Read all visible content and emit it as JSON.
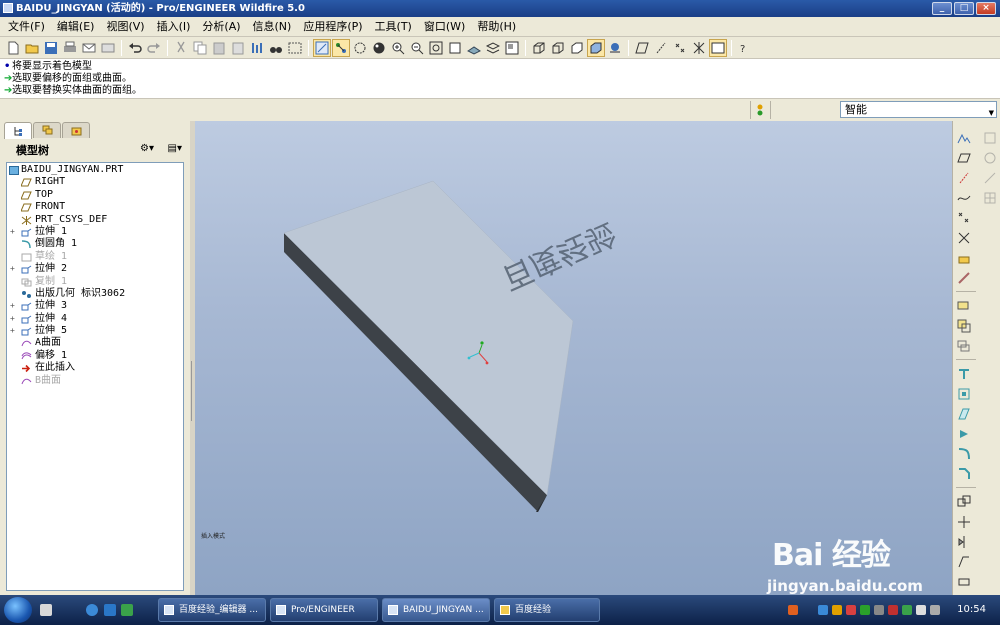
{
  "window": {
    "title": "BAIDU_JINGYAN (活动的) - Pro/ENGINEER Wildfire 5.0",
    "controls": [
      "minimize",
      "maximize",
      "close"
    ]
  },
  "menu": [
    {
      "label": "文件(F)"
    },
    {
      "label": "编辑(E)"
    },
    {
      "label": "视图(V)"
    },
    {
      "label": "插入(I)"
    },
    {
      "label": "分析(A)"
    },
    {
      "label": "信息(N)"
    },
    {
      "label": "应用程序(P)"
    },
    {
      "label": "工具(T)"
    },
    {
      "label": "窗口(W)"
    },
    {
      "label": "帮助(H)"
    }
  ],
  "messages": [
    {
      "text": "将要显示着色模型",
      "kind": "info"
    },
    {
      "text": "选取要偏移的面组或曲面。",
      "kind": "prompt"
    },
    {
      "text": "选取要替换实体曲面的面组。",
      "kind": "prompt"
    }
  ],
  "filter": {
    "selected": "智能"
  },
  "model_tree": {
    "title": "模型树",
    "items": [
      {
        "label": "BAIDU_JINGYAN.PRT",
        "icon": "part-icon",
        "expandable": false,
        "dim": false,
        "root": true
      },
      {
        "label": "RIGHT",
        "icon": "datum-plane-icon",
        "expandable": false,
        "dim": false
      },
      {
        "label": "TOP",
        "icon": "datum-plane-icon",
        "expandable": false,
        "dim": false
      },
      {
        "label": "FRONT",
        "icon": "datum-plane-icon",
        "expandable": false,
        "dim": false
      },
      {
        "label": "PRT_CSYS_DEF",
        "icon": "csys-icon",
        "expandable": false,
        "dim": false
      },
      {
        "label": "拉伸 1",
        "icon": "extrude-icon",
        "expandable": true,
        "dim": false
      },
      {
        "label": "倒圆角 1",
        "icon": "round-icon",
        "expandable": false,
        "dim": false
      },
      {
        "label": "草绘 1",
        "icon": "sketch-icon",
        "expandable": false,
        "dim": true
      },
      {
        "label": "拉伸 2",
        "icon": "extrude-icon",
        "expandable": true,
        "dim": false
      },
      {
        "label": "复制 1",
        "icon": "copy-icon",
        "expandable": false,
        "dim": true
      },
      {
        "label": "出版几何 标识3062",
        "icon": "publish-geom-icon",
        "expandable": false,
        "dim": false
      },
      {
        "label": "拉伸 3",
        "icon": "extrude-icon",
        "expandable": true,
        "dim": false
      },
      {
        "label": "拉伸 4",
        "icon": "extrude-icon",
        "expandable": true,
        "dim": false
      },
      {
        "label": "拉伸 5",
        "icon": "extrude-icon",
        "expandable": true,
        "dim": false
      },
      {
        "label": "A曲面",
        "icon": "surface-icon",
        "expandable": false,
        "dim": false
      },
      {
        "label": "偏移 1",
        "icon": "offset-icon",
        "expandable": false,
        "dim": false
      },
      {
        "label": "在此插入",
        "icon": "insert-here-icon",
        "expandable": false,
        "dim": false
      },
      {
        "label": "B曲面",
        "icon": "surface-icon",
        "expandable": false,
        "dim": true
      }
    ]
  },
  "graphics": {
    "engraved_text": "百度经验",
    "mode_label": "插入模式"
  },
  "watermark": {
    "brand": "Bai 经验",
    "url": "jingyan.baidu.com"
  },
  "taskbar": {
    "tasks": [
      {
        "label": "百度经验_编辑器 ...",
        "active": false
      },
      {
        "label": "Pro/ENGINEER",
        "active": false
      },
      {
        "label": "BAIDU_JINGYAN ...",
        "active": true
      },
      {
        "label": "百度经验",
        "active": false
      }
    ],
    "clock": "10:54"
  },
  "colors": {
    "titlebar": "#1f4a95",
    "panel": "#ece9d8",
    "graphics_top": "#bdcbe1",
    "graphics_bottom": "#8ea4c4",
    "model_top": "#bcc7d5",
    "model_side": "#3d4248"
  }
}
